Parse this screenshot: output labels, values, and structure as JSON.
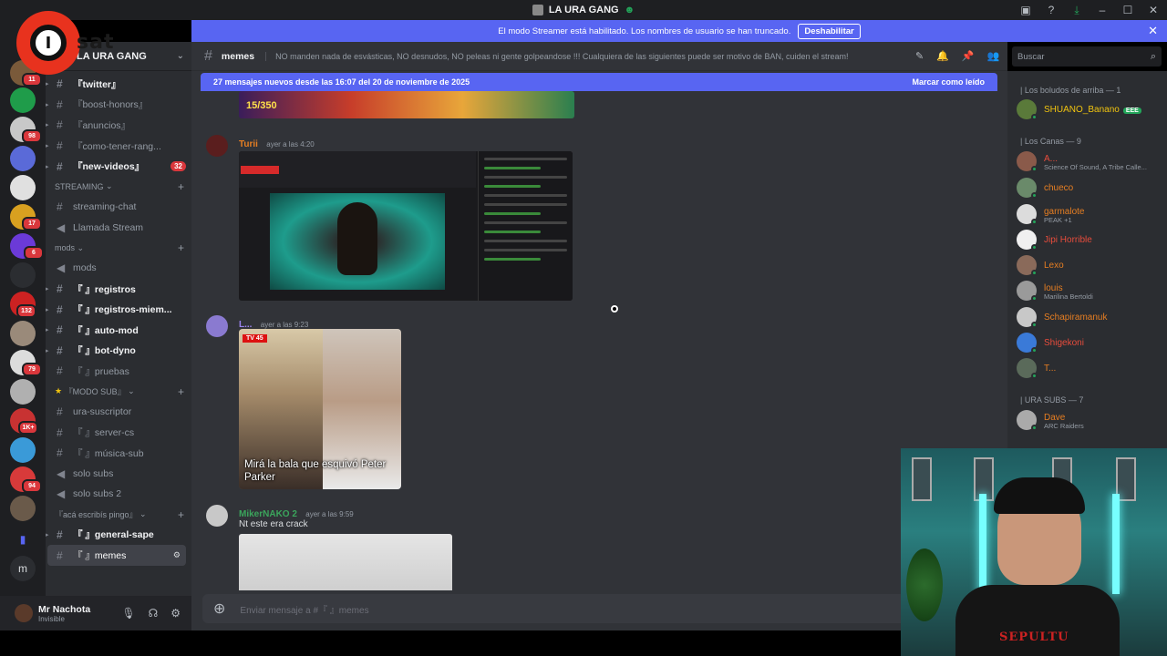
{
  "titlebar": {
    "title": "LA URA GANG"
  },
  "logo": {
    "letter": "I",
    "text": "sat"
  },
  "banner": {
    "text": "El modo Streamer está habilitado. Los nombres de usuario se han truncado.",
    "button": "Deshabilitar"
  },
  "rail_badges": [
    "11",
    "98",
    "17",
    "6",
    "132",
    "79",
    "1K+",
    "94"
  ],
  "sidebar": {
    "server_name": "LA URA GANG",
    "channels_top": [
      {
        "label": "『twitter』",
        "prefix": "» "
      },
      {
        "label": "『boost-honors』",
        "prefix": "» "
      },
      {
        "label": "『anuncios』",
        "prefix": "» "
      },
      {
        "label": "『como-tener-rang...",
        "prefix": "» "
      },
      {
        "label": "『new-videos』",
        "prefix": "» ",
        "count": "32"
      }
    ],
    "cat_streaming": "STREAMING",
    "streaming": [
      "streaming-chat",
      "Llamada Stream"
    ],
    "cat_mods": "mods",
    "mods": [
      {
        "label": "mods"
      },
      {
        "label": "『 』registros"
      },
      {
        "label": "『 』registros-miem..."
      },
      {
        "label": "『 』auto-mod"
      },
      {
        "label": "『 』bot-dyno"
      },
      {
        "label": "『 』pruebas"
      }
    ],
    "cat_sub": "『MODO SUB』",
    "sub": [
      "ura-suscriptor",
      "『 』server-cs",
      "『 』música-sub",
      "solo subs",
      "solo subs 2"
    ],
    "cat_pingo": "『acá escribís pingo』",
    "pingo": [
      "『 』general-sape",
      "『 』memes"
    ]
  },
  "user": {
    "name": "Mr Nachota",
    "status": "Invisible"
  },
  "channel": {
    "name": "memes",
    "topic": "NO manden nada de esvásticas, NO desnudos, NO peleas ni gente golpeandose !!! Cualquiera de las siguientes puede ser motivo de BAN, cuiden el stream!"
  },
  "newbar": {
    "text": "27 mensajes nuevos desde las 16:07 del 20 de noviembre de 2025",
    "action": "Marcar como leído"
  },
  "search": {
    "placeholder": "Buscar"
  },
  "messages": [
    {
      "author": "Turii",
      "time": "ayer a las 4:20",
      "color": "#e67e22"
    },
    {
      "author": "L...",
      "time": "ayer a las 9:23",
      "color": "#9b84ee",
      "gif_tag": "TV 45",
      "gif_caption": "Mirá la bala que esquivó Peter Parker"
    },
    {
      "author": "MikerNAKO 2",
      "time": "ayer a las 9:59",
      "color": "#3ba55c",
      "text": "Nt este era crack"
    }
  ],
  "img1_text": "15/350",
  "input": {
    "placeholder": "Enviar mensaje a #『 』memes"
  },
  "members": {
    "groups": [
      {
        "title": "| Los boludos de arriba — 1",
        "items": [
          {
            "name": "SHUANO_Banano",
            "color": "#f1c40f",
            "tag": "EEE"
          }
        ]
      },
      {
        "title": "| Los Canas — 9",
        "items": [
          {
            "name": "A...",
            "color": "#e74c3c",
            "sub": "Science Of Sound, A Tribe Calle..."
          },
          {
            "name": "chueco",
            "color": "#e67e22"
          },
          {
            "name": "garmalote",
            "color": "#e67e22",
            "sub": "PEAK +1"
          },
          {
            "name": "Jipi Horrible",
            "color": "#e74c3c"
          },
          {
            "name": "Lexo",
            "color": "#e67e22"
          },
          {
            "name": "louis",
            "color": "#e67e22",
            "sub": "Marilina Bertoldi"
          },
          {
            "name": "Schapiramanuk",
            "color": "#e67e22"
          },
          {
            "name": "Shigekoni",
            "color": "#e74c3c"
          },
          {
            "name": "T...",
            "color": "#e67e22"
          }
        ]
      },
      {
        "title": "| URA SUBS — 7",
        "items": [
          {
            "name": "Dave",
            "color": "#e67e22",
            "sub": "ARC Raiders"
          }
        ]
      }
    ]
  },
  "webcam": {
    "shirt_text": "SEPULTU"
  },
  "colors": {
    "blurple": "#5865f2",
    "bg_main": "#313338",
    "bg_side": "#2b2d31",
    "bg_rail": "#1e1f22"
  }
}
